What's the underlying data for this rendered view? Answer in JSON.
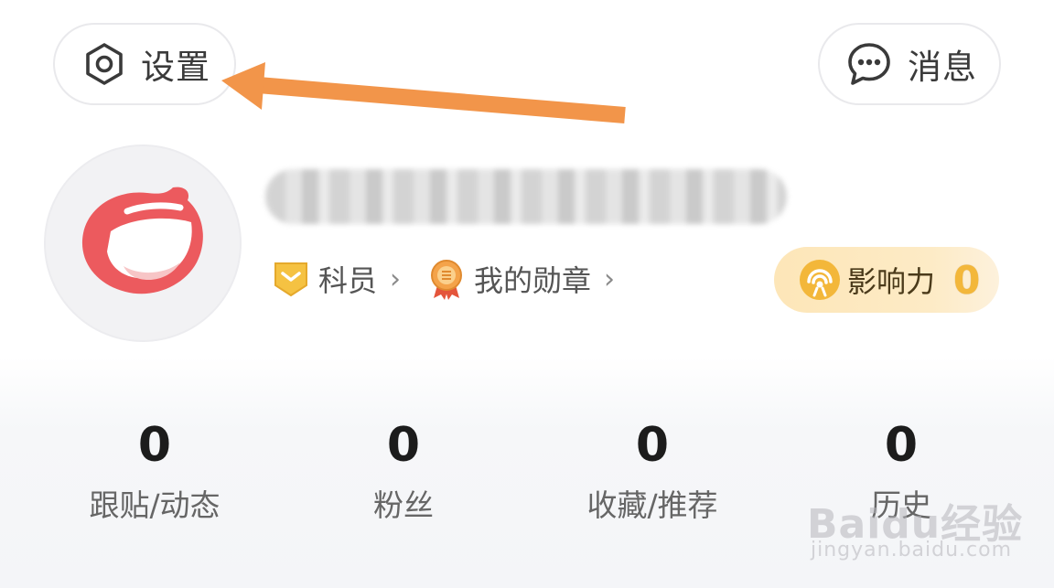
{
  "header": {
    "settings_label": "设置",
    "messages_label": "消息"
  },
  "profile": {
    "rank_label": "科员",
    "medals_label": "我的勋章",
    "chevron": "›",
    "influence": {
      "label": "影响力",
      "value": "0"
    }
  },
  "stats": [
    {
      "count": "0",
      "label": "跟贴/动态"
    },
    {
      "count": "0",
      "label": "粉丝"
    },
    {
      "count": "0",
      "label": "收藏/推荐"
    },
    {
      "count": "0",
      "label": "历史"
    }
  ],
  "watermark": {
    "brand": "Baidu经验",
    "url": "jingyan.baidu.com"
  },
  "colors": {
    "arrow": "#f2954a",
    "avatar_red": "#ec5a5e",
    "influence_gold": "#f3b73a",
    "rank_badge": "#f5c242"
  }
}
